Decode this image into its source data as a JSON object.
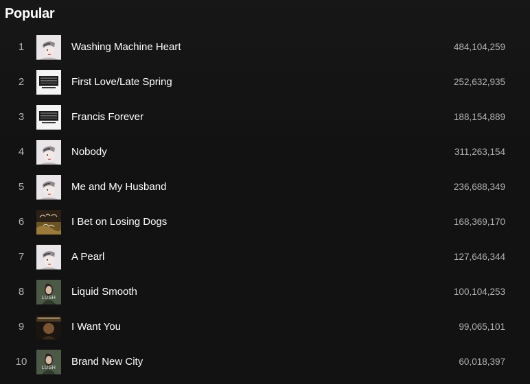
{
  "section": {
    "title": "Popular"
  },
  "tracks": [
    {
      "rank": "1",
      "title": "Washing Machine Heart",
      "plays": "484,104,259",
      "cover": "be-the-cowboy-cover"
    },
    {
      "rank": "2",
      "title": "First Love/Late Spring",
      "plays": "252,632,935",
      "cover": "bury-me-at-makeout-creek-cover"
    },
    {
      "rank": "3",
      "title": "Francis Forever",
      "plays": "188,154,889",
      "cover": "bury-me-at-makeout-creek-cover"
    },
    {
      "rank": "4",
      "title": "Nobody",
      "plays": "311,263,154",
      "cover": "be-the-cowboy-cover"
    },
    {
      "rank": "5",
      "title": "Me and My Husband",
      "plays": "236,688,349",
      "cover": "be-the-cowboy-cover"
    },
    {
      "rank": "6",
      "title": "I Bet on Losing Dogs",
      "plays": "168,369,170",
      "cover": "puberty-2-cover"
    },
    {
      "rank": "7",
      "title": "A Pearl",
      "plays": "127,646,344",
      "cover": "be-the-cowboy-cover"
    },
    {
      "rank": "8",
      "title": "Liquid Smooth",
      "plays": "100,104,253",
      "cover": "lush-cover",
      "cover_text": "LUSH"
    },
    {
      "rank": "9",
      "title": "I Want You",
      "plays": "99,065,101",
      "cover": "retired-from-sad-cover"
    },
    {
      "rank": "10",
      "title": "Brand New City",
      "plays": "60,018,397",
      "cover": "lush-cover",
      "cover_text": "LUSH"
    }
  ],
  "colors": {
    "background": "#121212",
    "primary_text": "#ffffff",
    "secondary_text": "#b3b3b3"
  }
}
